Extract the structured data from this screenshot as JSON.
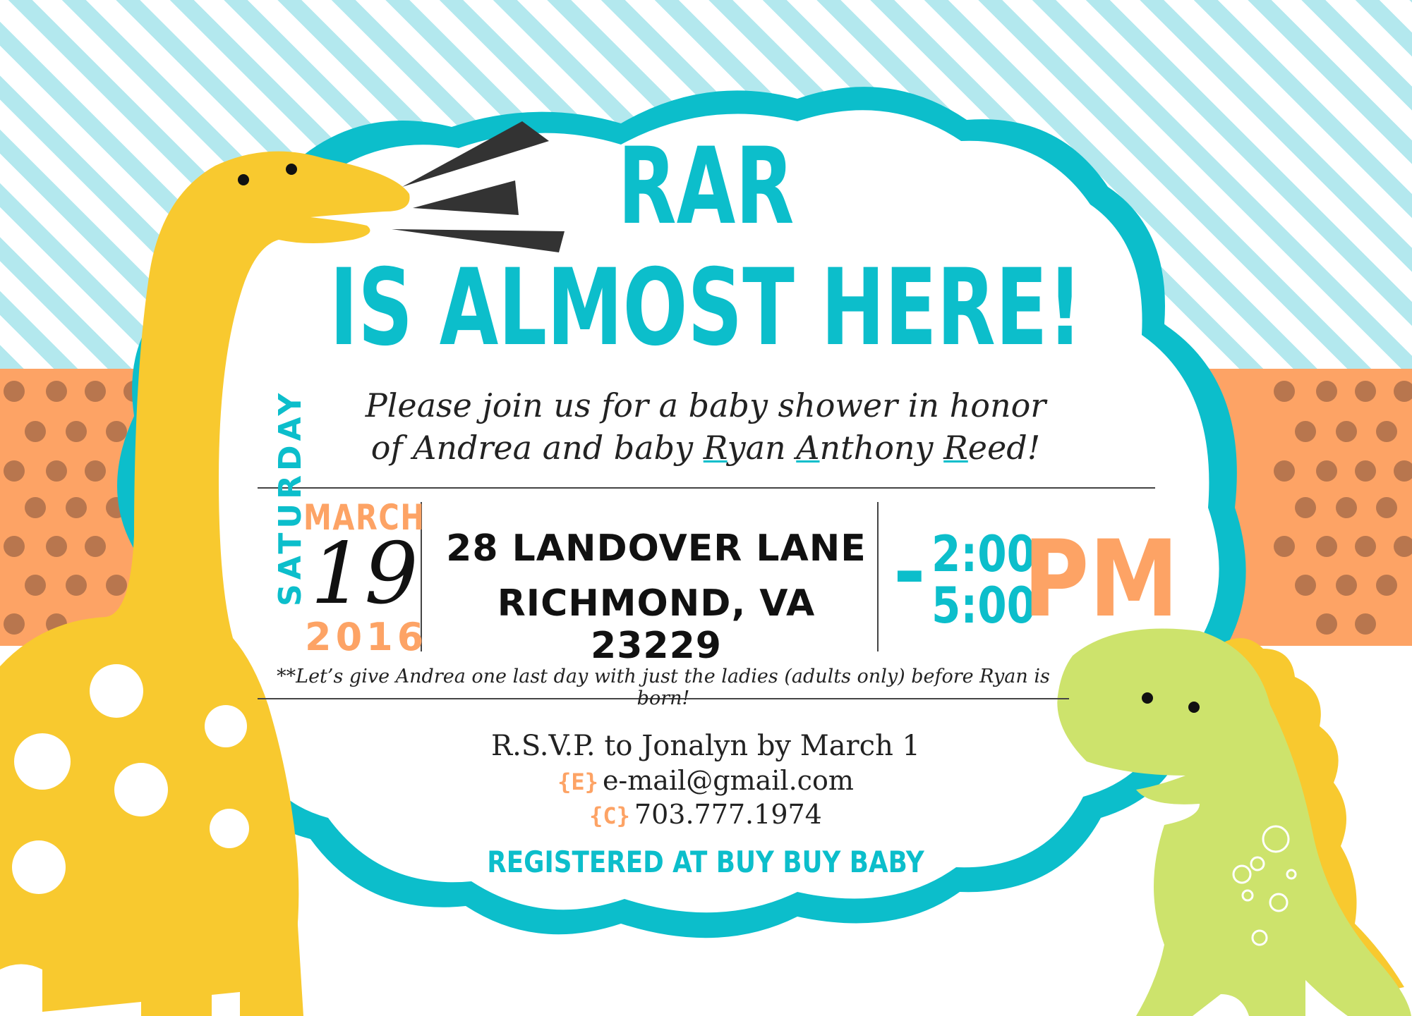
{
  "headline": {
    "line1": "RAR",
    "line2": "IS ALMOST HERE!"
  },
  "intro": {
    "line1": "Please join us for a baby shower in honor",
    "line2_prefix": "of Andrea and baby ",
    "initial1": "R",
    "name1_rest": "yan ",
    "initial2": "A",
    "name2_rest": "nthony ",
    "initial3": "R",
    "name3_rest": "eed!"
  },
  "event": {
    "weekday": "SATURDAY",
    "month": "MARCH",
    "day": "19",
    "year": "2016",
    "address_line1": "28 LANDOVER LANE",
    "address_line2": "RICHMOND, VA 23229",
    "time_dash": "-",
    "time_start": "2:00",
    "time_end": "5:00",
    "time_suffix": "PM"
  },
  "note": "**Let’s give Andrea one last day with just the ladies (adults only) before Ryan is born!",
  "rsvp": {
    "line": "R.S.V.P. to Jonalyn by March 1",
    "email_tag": "{E}",
    "email": "e-mail@gmail.com",
    "phone_tag": "{C}",
    "phone": "703.777.1974"
  },
  "registry": "REGISTERED AT BUY BUY BABY",
  "colors": {
    "teal": "#0cbecb",
    "orange": "#fda365",
    "stripe": "#b3e8ee",
    "yellow_dino": "#f8c92f",
    "green_dino": "#cde36c",
    "dot": "#b8764e"
  },
  "icons": {
    "long_neck_dino": "yellow-brachiosaurus-illustration",
    "small_dino": "green-t-rex-illustration",
    "roar_marks": "roar-lines-icon"
  }
}
